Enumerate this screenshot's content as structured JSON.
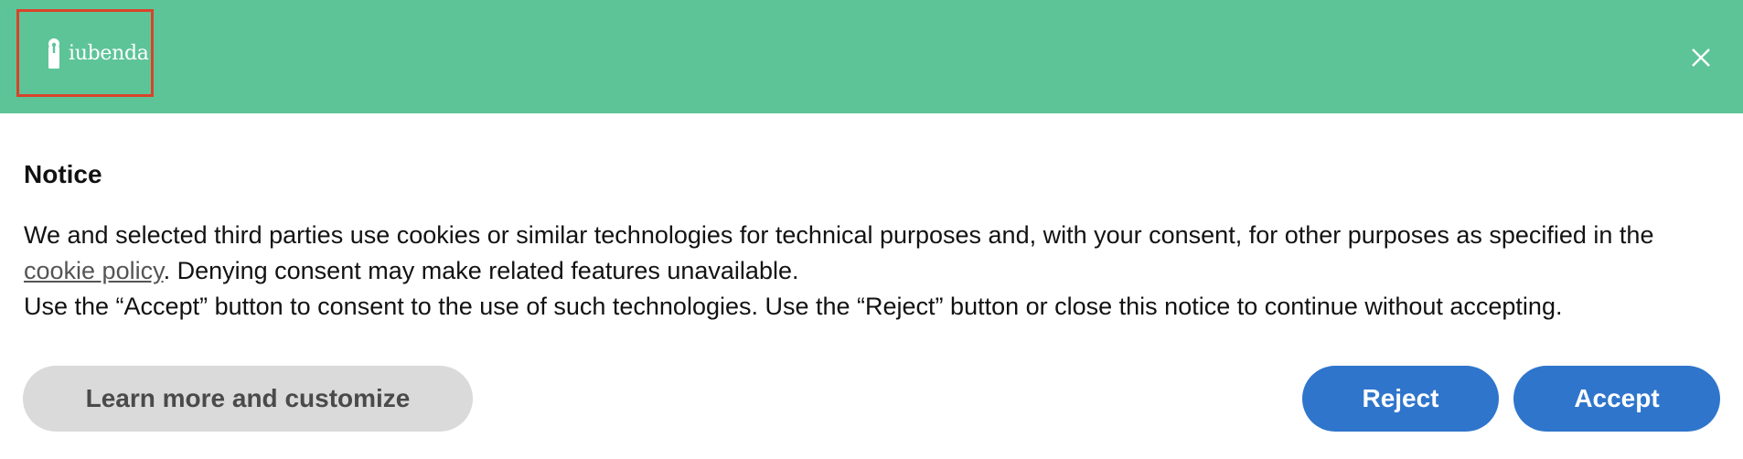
{
  "header": {
    "brand_name": "iubenda",
    "brand_icon": "keyhole-icon",
    "close_icon": "close-icon",
    "background_color": "#5dc498",
    "highlight_color": "#d9432a"
  },
  "notice": {
    "title": "Notice",
    "line1_text": "We and selected third parties use cookies or similar technologies for technical purposes and, with your consent, for other purposes as specified in the ",
    "cookie_policy_link": "cookie policy",
    "line1_suffix": ". Denying consent may make related features unavailable.",
    "line2_text": "Use the “Accept” button to consent to the use of such technologies. Use the “Reject” button or close this notice to continue without accepting."
  },
  "buttons": {
    "customize_label": "Learn more and customize",
    "reject_label": "Reject",
    "accept_label": "Accept",
    "primary_color": "#2f75cc",
    "secondary_color": "#dadada"
  }
}
